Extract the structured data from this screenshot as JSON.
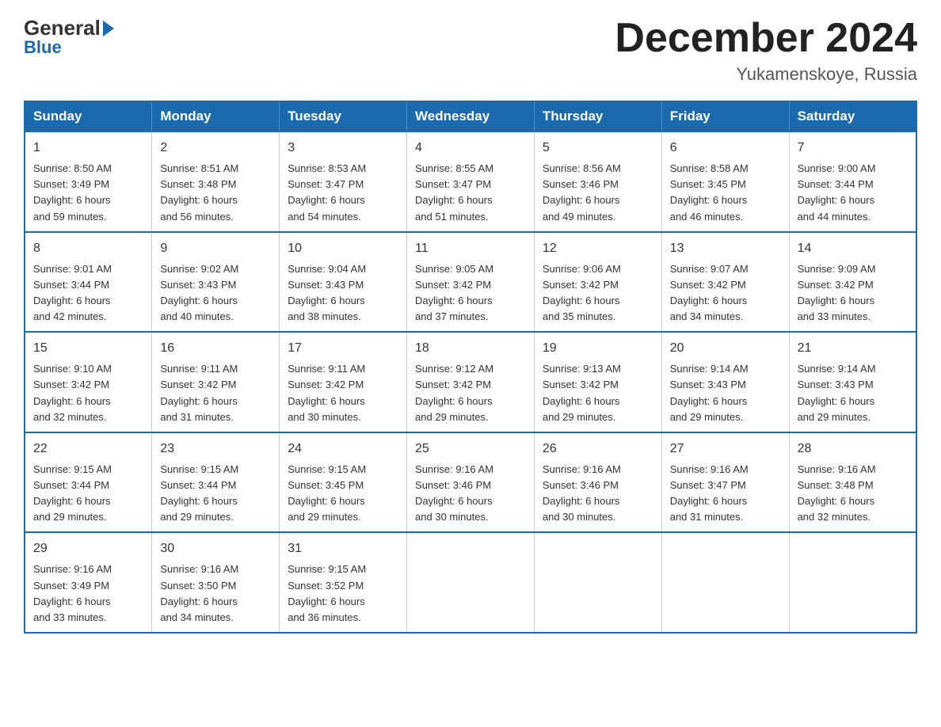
{
  "logo": {
    "general": "General",
    "blue": "Blue"
  },
  "title": "December 2024",
  "subtitle": "Yukamenskoye, Russia",
  "days_of_week": [
    "Sunday",
    "Monday",
    "Tuesday",
    "Wednesday",
    "Thursday",
    "Friday",
    "Saturday"
  ],
  "weeks": [
    [
      {
        "day": "1",
        "info": "Sunrise: 8:50 AM\nSunset: 3:49 PM\nDaylight: 6 hours\nand 59 minutes."
      },
      {
        "day": "2",
        "info": "Sunrise: 8:51 AM\nSunset: 3:48 PM\nDaylight: 6 hours\nand 56 minutes."
      },
      {
        "day": "3",
        "info": "Sunrise: 8:53 AM\nSunset: 3:47 PM\nDaylight: 6 hours\nand 54 minutes."
      },
      {
        "day": "4",
        "info": "Sunrise: 8:55 AM\nSunset: 3:47 PM\nDaylight: 6 hours\nand 51 minutes."
      },
      {
        "day": "5",
        "info": "Sunrise: 8:56 AM\nSunset: 3:46 PM\nDaylight: 6 hours\nand 49 minutes."
      },
      {
        "day": "6",
        "info": "Sunrise: 8:58 AM\nSunset: 3:45 PM\nDaylight: 6 hours\nand 46 minutes."
      },
      {
        "day": "7",
        "info": "Sunrise: 9:00 AM\nSunset: 3:44 PM\nDaylight: 6 hours\nand 44 minutes."
      }
    ],
    [
      {
        "day": "8",
        "info": "Sunrise: 9:01 AM\nSunset: 3:44 PM\nDaylight: 6 hours\nand 42 minutes."
      },
      {
        "day": "9",
        "info": "Sunrise: 9:02 AM\nSunset: 3:43 PM\nDaylight: 6 hours\nand 40 minutes."
      },
      {
        "day": "10",
        "info": "Sunrise: 9:04 AM\nSunset: 3:43 PM\nDaylight: 6 hours\nand 38 minutes."
      },
      {
        "day": "11",
        "info": "Sunrise: 9:05 AM\nSunset: 3:42 PM\nDaylight: 6 hours\nand 37 minutes."
      },
      {
        "day": "12",
        "info": "Sunrise: 9:06 AM\nSunset: 3:42 PM\nDaylight: 6 hours\nand 35 minutes."
      },
      {
        "day": "13",
        "info": "Sunrise: 9:07 AM\nSunset: 3:42 PM\nDaylight: 6 hours\nand 34 minutes."
      },
      {
        "day": "14",
        "info": "Sunrise: 9:09 AM\nSunset: 3:42 PM\nDaylight: 6 hours\nand 33 minutes."
      }
    ],
    [
      {
        "day": "15",
        "info": "Sunrise: 9:10 AM\nSunset: 3:42 PM\nDaylight: 6 hours\nand 32 minutes."
      },
      {
        "day": "16",
        "info": "Sunrise: 9:11 AM\nSunset: 3:42 PM\nDaylight: 6 hours\nand 31 minutes."
      },
      {
        "day": "17",
        "info": "Sunrise: 9:11 AM\nSunset: 3:42 PM\nDaylight: 6 hours\nand 30 minutes."
      },
      {
        "day": "18",
        "info": "Sunrise: 9:12 AM\nSunset: 3:42 PM\nDaylight: 6 hours\nand 29 minutes."
      },
      {
        "day": "19",
        "info": "Sunrise: 9:13 AM\nSunset: 3:42 PM\nDaylight: 6 hours\nand 29 minutes."
      },
      {
        "day": "20",
        "info": "Sunrise: 9:14 AM\nSunset: 3:43 PM\nDaylight: 6 hours\nand 29 minutes."
      },
      {
        "day": "21",
        "info": "Sunrise: 9:14 AM\nSunset: 3:43 PM\nDaylight: 6 hours\nand 29 minutes."
      }
    ],
    [
      {
        "day": "22",
        "info": "Sunrise: 9:15 AM\nSunset: 3:44 PM\nDaylight: 6 hours\nand 29 minutes."
      },
      {
        "day": "23",
        "info": "Sunrise: 9:15 AM\nSunset: 3:44 PM\nDaylight: 6 hours\nand 29 minutes."
      },
      {
        "day": "24",
        "info": "Sunrise: 9:15 AM\nSunset: 3:45 PM\nDaylight: 6 hours\nand 29 minutes."
      },
      {
        "day": "25",
        "info": "Sunrise: 9:16 AM\nSunset: 3:46 PM\nDaylight: 6 hours\nand 30 minutes."
      },
      {
        "day": "26",
        "info": "Sunrise: 9:16 AM\nSunset: 3:46 PM\nDaylight: 6 hours\nand 30 minutes."
      },
      {
        "day": "27",
        "info": "Sunrise: 9:16 AM\nSunset: 3:47 PM\nDaylight: 6 hours\nand 31 minutes."
      },
      {
        "day": "28",
        "info": "Sunrise: 9:16 AM\nSunset: 3:48 PM\nDaylight: 6 hours\nand 32 minutes."
      }
    ],
    [
      {
        "day": "29",
        "info": "Sunrise: 9:16 AM\nSunset: 3:49 PM\nDaylight: 6 hours\nand 33 minutes."
      },
      {
        "day": "30",
        "info": "Sunrise: 9:16 AM\nSunset: 3:50 PM\nDaylight: 6 hours\nand 34 minutes."
      },
      {
        "day": "31",
        "info": "Sunrise: 9:15 AM\nSunset: 3:52 PM\nDaylight: 6 hours\nand 36 minutes."
      },
      {
        "day": "",
        "info": ""
      },
      {
        "day": "",
        "info": ""
      },
      {
        "day": "",
        "info": ""
      },
      {
        "day": "",
        "info": ""
      }
    ]
  ]
}
